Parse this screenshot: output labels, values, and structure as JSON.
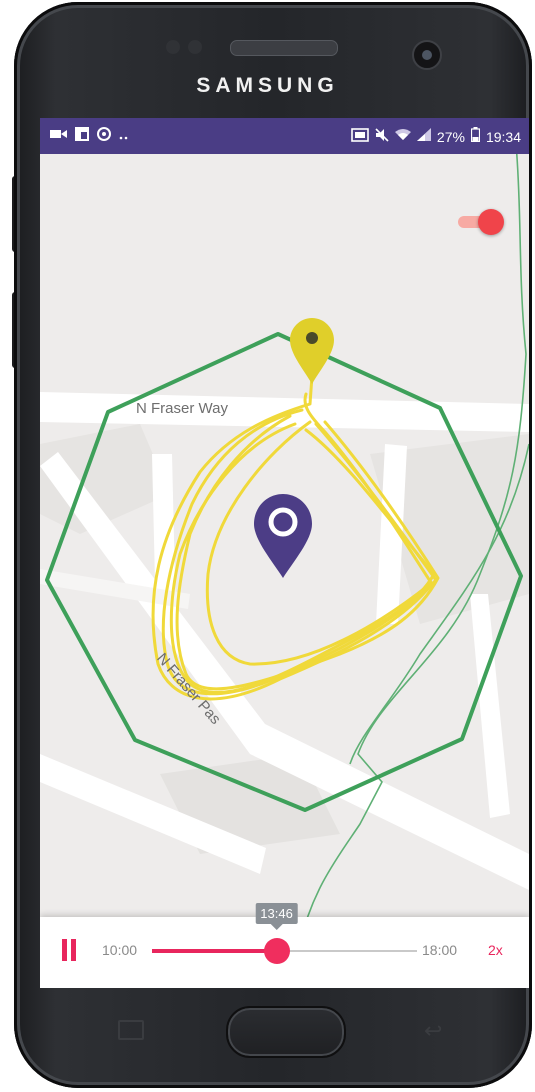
{
  "device": {
    "brand": "SAMSUNG"
  },
  "status_bar": {
    "left_icons": [
      "video-icon",
      "flipboard-icon",
      "cast-icon",
      "more-notifications-icon"
    ],
    "right_icons": [
      "screen-mirror-icon",
      "mute-icon",
      "wifi-icon",
      "signal-icon",
      "battery-icon"
    ],
    "battery": "27%",
    "time": "19:34",
    "color": "#4a3d85"
  },
  "map": {
    "roads": [
      "N Fraser Way",
      "N Fraser Pas"
    ],
    "colors": {
      "geofence": "#3ea05a",
      "track": "#f0d93a",
      "current_marker": "#4c3d86",
      "start_marker": "#e0cf2a"
    }
  },
  "toggle": {
    "state": "on",
    "accent": "#f0444a"
  },
  "playback": {
    "start": "10:00",
    "end": "18:00",
    "current": "13:46",
    "progress": 0.47,
    "speed": "2x",
    "accent": "#e8265d"
  }
}
